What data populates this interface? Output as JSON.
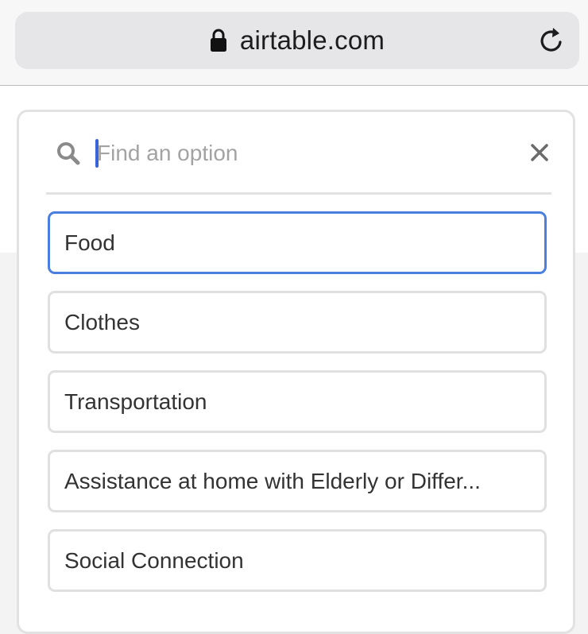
{
  "browser": {
    "url": "airtable.com",
    "icons": {
      "lock": "lock-icon",
      "reload": "reload-icon"
    }
  },
  "dropdown": {
    "search": {
      "placeholder": "Find an option",
      "value": "",
      "icons": {
        "search": "search-icon",
        "clear": "close-icon"
      }
    },
    "options": [
      {
        "label": "Food",
        "selected": true
      },
      {
        "label": "Clothes",
        "selected": false
      },
      {
        "label": "Transportation",
        "selected": false
      },
      {
        "label": "Assistance at home with Elderly or Differ...",
        "selected": false
      },
      {
        "label": "Social Connection",
        "selected": false
      }
    ]
  },
  "colors": {
    "accent": "#4a7fe0",
    "caret": "#3b63d8",
    "option_border": "#e0e0e0",
    "text": "#333333",
    "placeholder": "#a3a3a3"
  }
}
